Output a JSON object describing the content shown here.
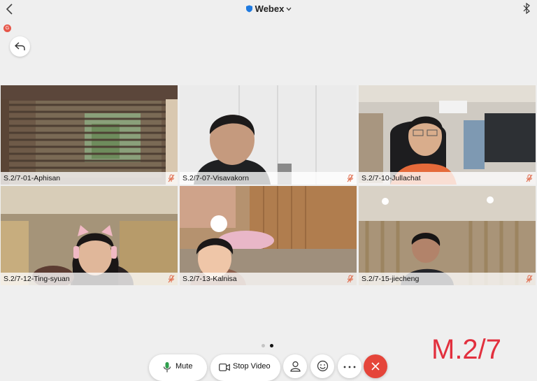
{
  "header": {
    "title": "Webex"
  },
  "recording_badge": "G",
  "participants": [
    {
      "name": "S.2/7-01-Aphisan"
    },
    {
      "name": "S.2/7-07-Visavakorn"
    },
    {
      "name": "S.2/7-10-Jullachat"
    },
    {
      "name": "S.2/7-12-Ting-syuan"
    },
    {
      "name": "S.2/7-13-Kalnisa"
    },
    {
      "name": "S.2/7-15-jiecheng"
    }
  ],
  "pager": {
    "page": 2,
    "total": 2
  },
  "watermark": "M.2/7",
  "controls": {
    "mute_label": "Mute",
    "stop_video_label": "Stop Video"
  },
  "colors": {
    "end_call": "#e5453a",
    "mute_indicator": "#e06a4a",
    "mic_green": "#2e9e4c",
    "webex_blue": "#1f7ae0"
  }
}
